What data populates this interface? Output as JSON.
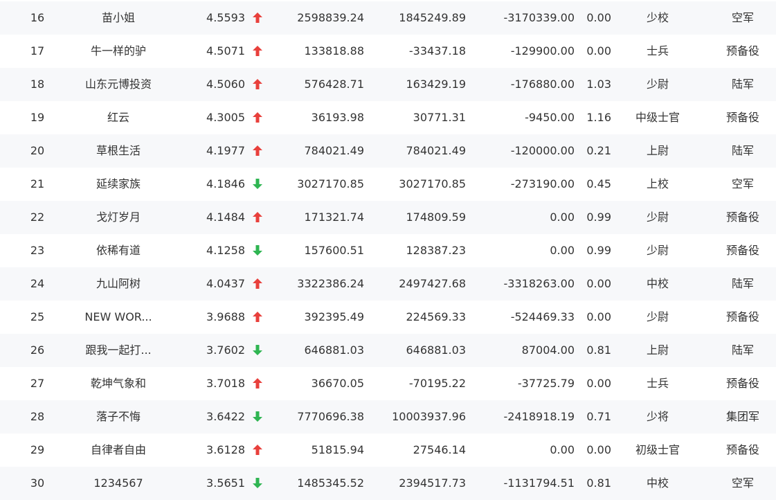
{
  "colors": {
    "up": "#e8403c",
    "down": "#2fb552",
    "stripe": "#f7f8fa",
    "text": "#333333"
  },
  "rows": [
    {
      "rank": "16",
      "name": "苗小姐",
      "score": "4.5593",
      "trend": "up",
      "v1": "2598839.24",
      "v2": "1845249.89",
      "v3": "-3170339.00",
      "ratio": "0.00",
      "title": "少校",
      "unit": "空军"
    },
    {
      "rank": "17",
      "name": "牛一样的驴",
      "score": "4.5071",
      "trend": "up",
      "v1": "133818.88",
      "v2": "-33437.18",
      "v3": "-129900.00",
      "ratio": "0.00",
      "title": "士兵",
      "unit": "预备役"
    },
    {
      "rank": "18",
      "name": "山东元博投资",
      "score": "4.5060",
      "trend": "up",
      "v1": "576428.71",
      "v2": "163429.19",
      "v3": "-176880.00",
      "ratio": "1.03",
      "title": "少尉",
      "unit": "陆军"
    },
    {
      "rank": "19",
      "name": "红云",
      "score": "4.3005",
      "trend": "up",
      "v1": "36193.98",
      "v2": "30771.31",
      "v3": "-9450.00",
      "ratio": "1.16",
      "title": "中级士官",
      "unit": "预备役"
    },
    {
      "rank": "20",
      "name": "草根生活",
      "score": "4.1977",
      "trend": "up",
      "v1": "784021.49",
      "v2": "784021.49",
      "v3": "-120000.00",
      "ratio": "0.21",
      "title": "上尉",
      "unit": "陆军"
    },
    {
      "rank": "21",
      "name": "延续家族",
      "score": "4.1846",
      "trend": "down",
      "v1": "3027170.85",
      "v2": "3027170.85",
      "v3": "-273190.00",
      "ratio": "0.45",
      "title": "上校",
      "unit": "空军"
    },
    {
      "rank": "22",
      "name": "戈灯岁月",
      "score": "4.1484",
      "trend": "up",
      "v1": "171321.74",
      "v2": "174809.59",
      "v3": "0.00",
      "ratio": "0.99",
      "title": "少尉",
      "unit": "预备役"
    },
    {
      "rank": "23",
      "name": "依稀有道",
      "score": "4.1258",
      "trend": "down",
      "v1": "157600.51",
      "v2": "128387.23",
      "v3": "0.00",
      "ratio": "0.99",
      "title": "少尉",
      "unit": "预备役"
    },
    {
      "rank": "24",
      "name": "九山阿树",
      "score": "4.0437",
      "trend": "up",
      "v1": "3322386.24",
      "v2": "2497427.68",
      "v3": "-3318263.00",
      "ratio": "0.00",
      "title": "中校",
      "unit": "陆军"
    },
    {
      "rank": "25",
      "name": "NEW WOR...",
      "score": "3.9688",
      "trend": "up",
      "v1": "392395.49",
      "v2": "224569.33",
      "v3": "-524469.33",
      "ratio": "0.00",
      "title": "少尉",
      "unit": "预备役"
    },
    {
      "rank": "26",
      "name": "跟我一起打...",
      "score": "3.7602",
      "trend": "down",
      "v1": "646881.03",
      "v2": "646881.03",
      "v3": "87004.00",
      "ratio": "0.81",
      "title": "上尉",
      "unit": "陆军"
    },
    {
      "rank": "27",
      "name": "乾坤气象和",
      "score": "3.7018",
      "trend": "up",
      "v1": "36670.05",
      "v2": "-70195.22",
      "v3": "-37725.79",
      "ratio": "0.00",
      "title": "士兵",
      "unit": "预备役"
    },
    {
      "rank": "28",
      "name": "落子不悔",
      "score": "3.6422",
      "trend": "down",
      "v1": "7770696.38",
      "v2": "10003937.96",
      "v3": "-2418918.19",
      "ratio": "0.71",
      "title": "少将",
      "unit": "集团军"
    },
    {
      "rank": "29",
      "name": "自律者自由",
      "score": "3.6128",
      "trend": "up",
      "v1": "51815.94",
      "v2": "27546.14",
      "v3": "0.00",
      "ratio": "0.00",
      "title": "初级士官",
      "unit": "预备役"
    },
    {
      "rank": "30",
      "name": "1234567",
      "score": "3.5651",
      "trend": "down",
      "v1": "1485345.52",
      "v2": "2394517.73",
      "v3": "-1131794.51",
      "ratio": "0.81",
      "title": "中校",
      "unit": "空军"
    }
  ]
}
